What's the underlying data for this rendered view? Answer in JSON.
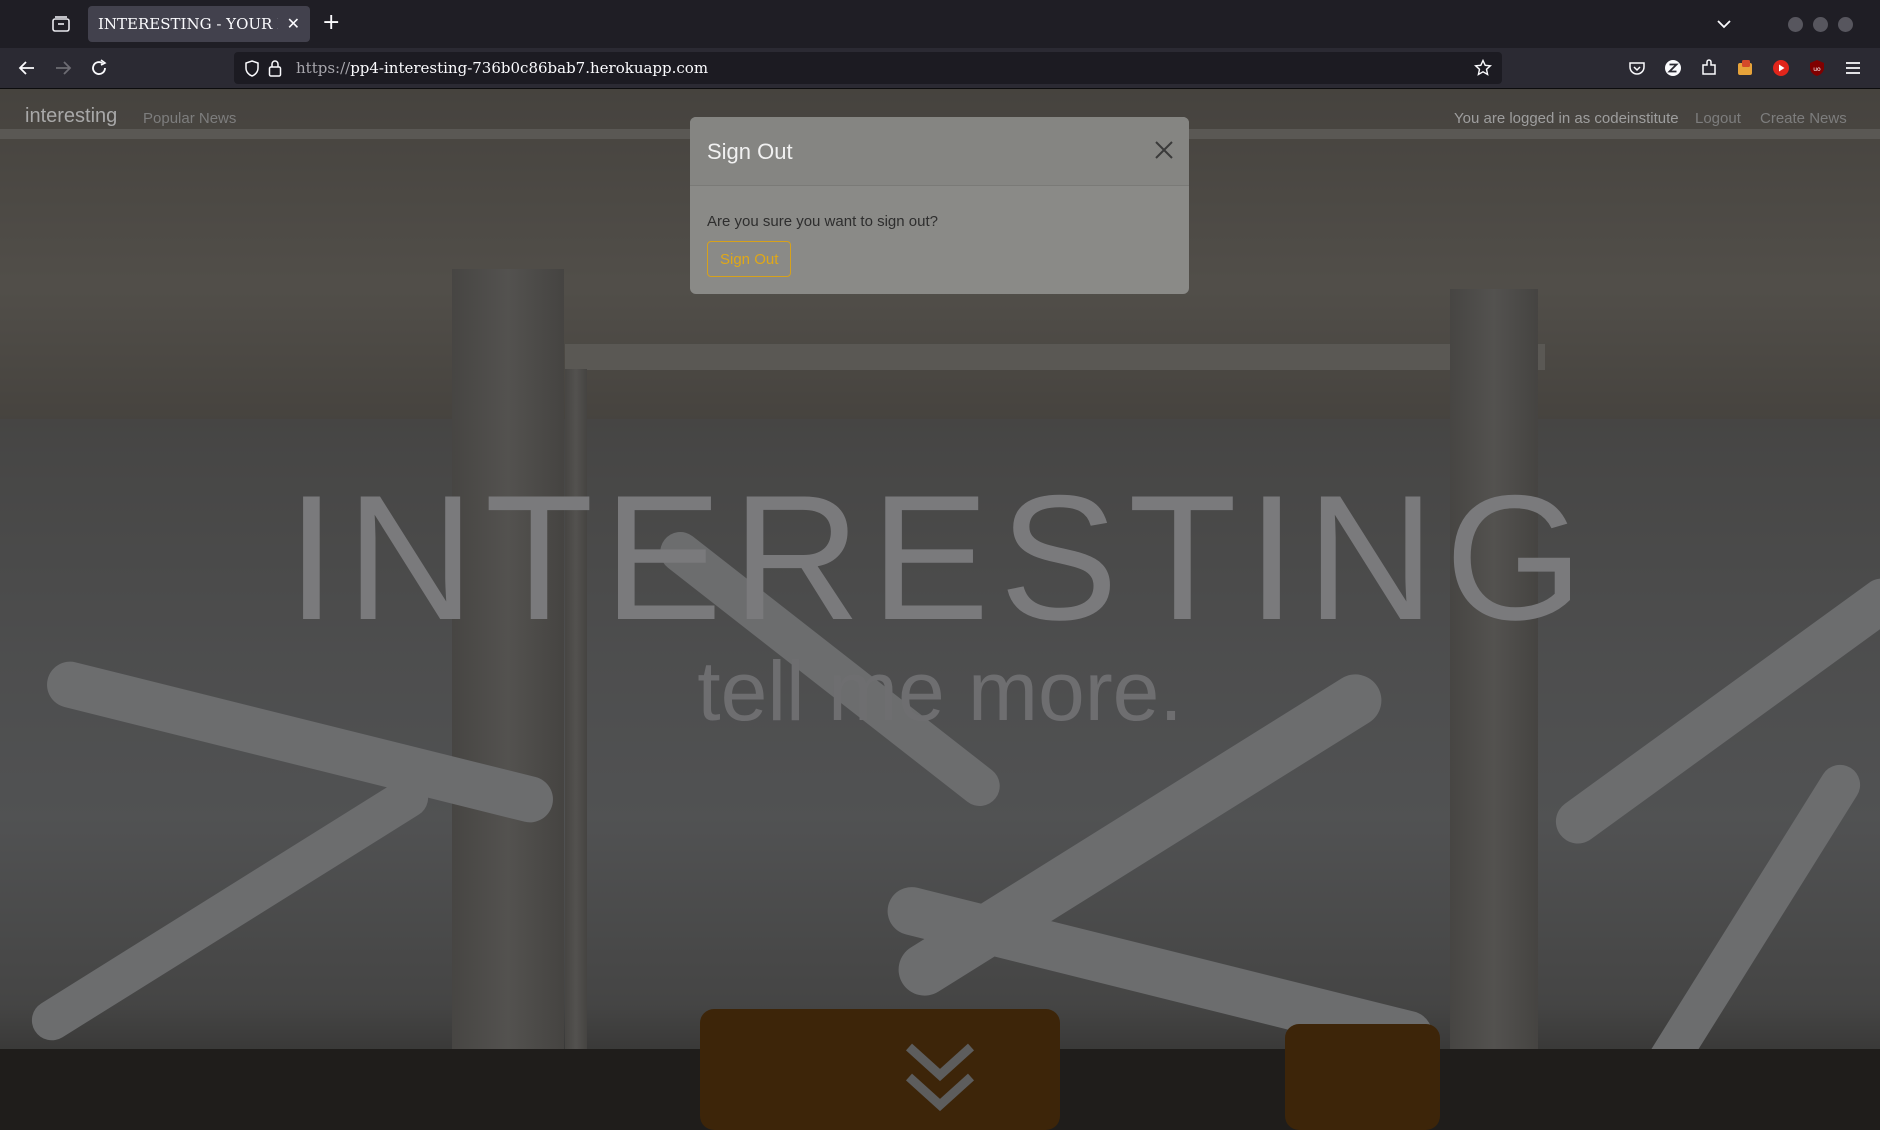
{
  "browser": {
    "tab_title": "INTERESTING - YOUR NEWS",
    "url_protocol": "https://",
    "url_host": "pp4-interesting-736b0c86bab7.herokuapp.com"
  },
  "site_nav": {
    "brand": "interesting",
    "popular_news": "Popular News",
    "logged_in_text": "You are logged in as codeinstitute",
    "logout": "Logout",
    "create_news": "Create News"
  },
  "hero": {
    "title": "INTERESTING",
    "subtitle": "tell me more."
  },
  "modal": {
    "title": "Sign Out",
    "message": "Are you sure you want to sign out?",
    "confirm_label": "Sign Out"
  },
  "colors": {
    "accent": "#e0a817",
    "chrome_bg": "#1f1e25",
    "overlay": "rgba(0,0,0,0.5)"
  }
}
